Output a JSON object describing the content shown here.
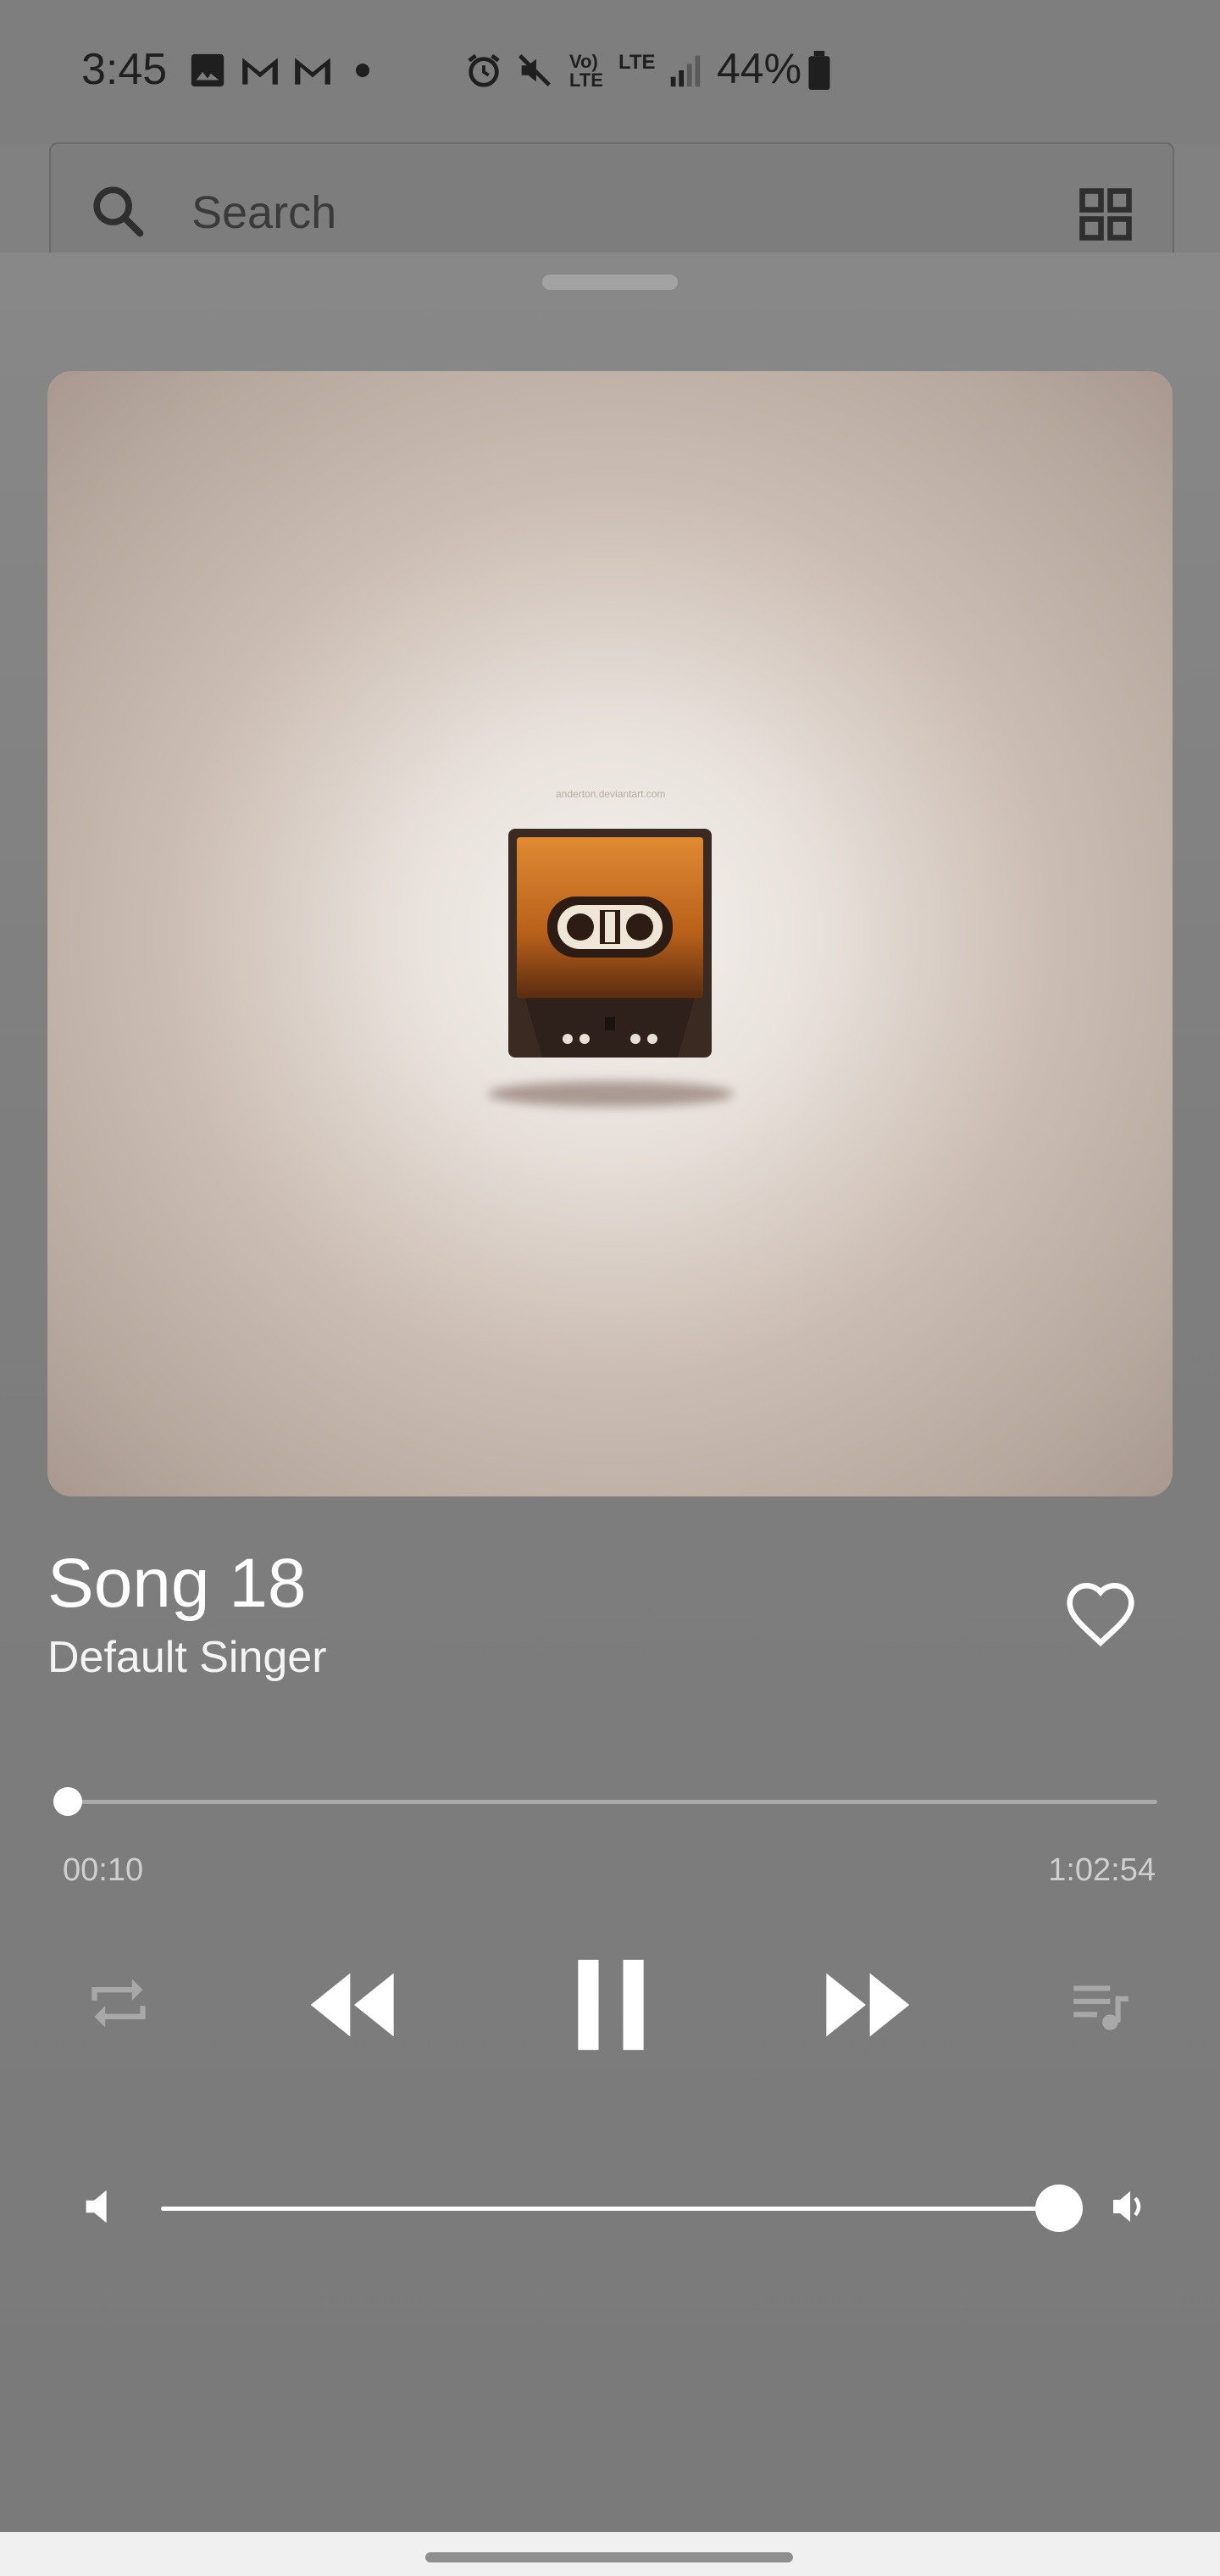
{
  "status_bar": {
    "time": "3:45",
    "network": "Vo) LTE",
    "lte": "LTE",
    "battery": "44%"
  },
  "search": {
    "label": "Search"
  },
  "now_playing": {
    "title": "Song 18",
    "artist": "Default Singer",
    "elapsed": "00:10",
    "duration": "1:02:54",
    "progress_fraction": 0.003,
    "volume_fraction": 1.0,
    "liked": false,
    "playing": true
  },
  "album_art": {
    "watermark": "anderton.deviantart.com"
  },
  "colors": {
    "sheet_bg": "#818181",
    "accent": "#ffffff",
    "cassette_orange": "#c96a1c"
  },
  "icons": [
    "search-icon",
    "grid-view-icon",
    "heart-icon",
    "repeat-icon",
    "rewind-icon",
    "pause-icon",
    "fast-forward-icon",
    "queue-icon",
    "volume-low-icon",
    "volume-high-icon"
  ]
}
